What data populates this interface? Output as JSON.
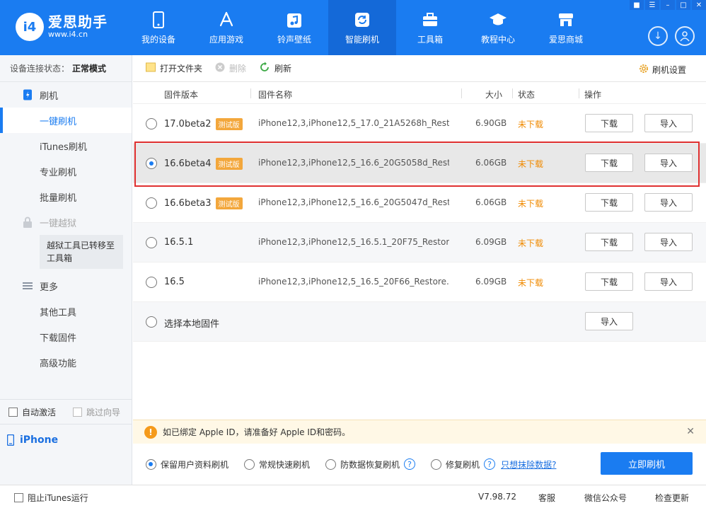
{
  "app": {
    "logo_mark": "i4",
    "name": "爱思助手",
    "url": "www.i4.cn"
  },
  "nav": [
    {
      "label": "我的设备",
      "icon": "phone-icon"
    },
    {
      "label": "应用游戏",
      "icon": "appstore-icon"
    },
    {
      "label": "铃声壁纸",
      "icon": "music-icon"
    },
    {
      "label": "智能刷机",
      "icon": "refresh-icon",
      "active": true
    },
    {
      "label": "工具箱",
      "icon": "toolbox-icon"
    },
    {
      "label": "教程中心",
      "icon": "graduation-cap-icon"
    },
    {
      "label": "爱思商城",
      "icon": "store-icon"
    }
  ],
  "sidebar": {
    "status_label": "设备连接状态：",
    "status_value": "正常模式",
    "flash_group": "刷机",
    "items": [
      "一键刷机",
      "iTunes刷机",
      "专业刷机",
      "批量刷机"
    ],
    "jailbreak_group": "一键越狱",
    "jailbreak_note": "越狱工具已转移至工具箱",
    "more_group": "更多",
    "more_items": [
      "其他工具",
      "下载固件",
      "高级功能"
    ],
    "auto_activate": "自动激活",
    "skip_guide": "跳过向导",
    "device": "iPhone"
  },
  "toolbar": {
    "open_folder": "打开文件夹",
    "delete": "删除",
    "refresh": "刷新",
    "settings": "刷机设置"
  },
  "table": {
    "headers": {
      "version": "固件版本",
      "name": "固件名称",
      "size": "大小",
      "status": "状态",
      "action": "操作"
    },
    "beta_badge": "测试版",
    "download": "下载",
    "import": "导入",
    "rows": [
      {
        "version": "17.0beta2",
        "beta": true,
        "name": "iPhone12,3,iPhone12,5_17.0_21A5268h_Rest...",
        "size": "6.90GB",
        "status": "未下载"
      },
      {
        "version": "16.6beta4",
        "beta": true,
        "name": "iPhone12,3,iPhone12,5_16.6_20G5058d_Rest...",
        "size": "6.06GB",
        "status": "未下载",
        "selected": true
      },
      {
        "version": "16.6beta3",
        "beta": true,
        "name": "iPhone12,3,iPhone12,5_16.6_20G5047d_Rest...",
        "size": "6.06GB",
        "status": "未下载"
      },
      {
        "version": "16.5.1",
        "beta": false,
        "name": "iPhone12,3,iPhone12,5_16.5.1_20F75_Restore...",
        "size": "6.09GB",
        "status": "未下载"
      },
      {
        "version": "16.5",
        "beta": false,
        "name": "iPhone12,3,iPhone12,5_16.5_20F66_Restore.i...",
        "size": "6.09GB",
        "status": "未下载"
      }
    ],
    "local_firmware": "选择本地固件"
  },
  "notice": "如已绑定 Apple ID，请准备好 Apple ID和密码。",
  "options": {
    "keep_data": "保留用户资料刷机",
    "quick": "常规快速刷机",
    "anti_recovery": "防数据恢复刷机",
    "repair": "修复刷机",
    "erase_link": "只想抹除数据?",
    "flash_now": "立即刷机"
  },
  "statusbar": {
    "block_itunes": "阻止iTunes运行",
    "version": "V7.98.72",
    "service": "客服",
    "wechat": "微信公众号",
    "check_update": "检查更新"
  },
  "colors": {
    "brand": "#1a7cf1",
    "status_orange": "#f08a00",
    "beta_badge": "#f3a73c",
    "highlight_border": "#e03030"
  }
}
